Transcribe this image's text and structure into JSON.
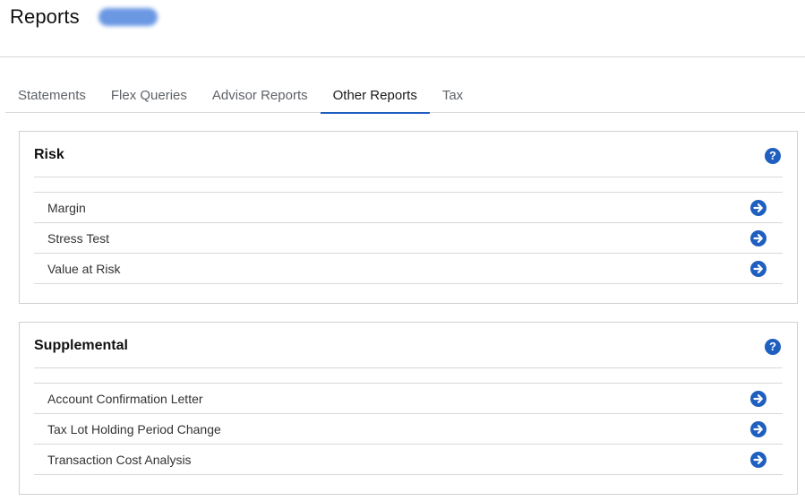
{
  "header": {
    "title": "Reports"
  },
  "tabs": [
    {
      "label": "Statements",
      "active": false
    },
    {
      "label": "Flex Queries",
      "active": false
    },
    {
      "label": "Advisor Reports",
      "active": false
    },
    {
      "label": "Other Reports",
      "active": true
    },
    {
      "label": "Tax",
      "active": false
    }
  ],
  "sections": [
    {
      "title": "Risk",
      "help_icon": "question-circle-icon",
      "items": [
        {
          "label": "Margin",
          "icon": "arrow-right-circle-icon"
        },
        {
          "label": "Stress Test",
          "icon": "arrow-right-circle-icon"
        },
        {
          "label": "Value at Risk",
          "icon": "arrow-right-circle-icon"
        }
      ]
    },
    {
      "title": "Supplemental",
      "help_icon": "question-circle-icon",
      "items": [
        {
          "label": "Account Confirmation Letter",
          "icon": "arrow-right-circle-icon"
        },
        {
          "label": "Tax Lot Holding Period Change",
          "icon": "arrow-right-circle-icon"
        },
        {
          "label": "Transaction Cost Analysis",
          "icon": "arrow-right-circle-icon"
        }
      ]
    }
  ],
  "colors": {
    "accent": "#1f5fbf",
    "border": "#d9d9d9",
    "tab_inactive": "#5f6368"
  }
}
